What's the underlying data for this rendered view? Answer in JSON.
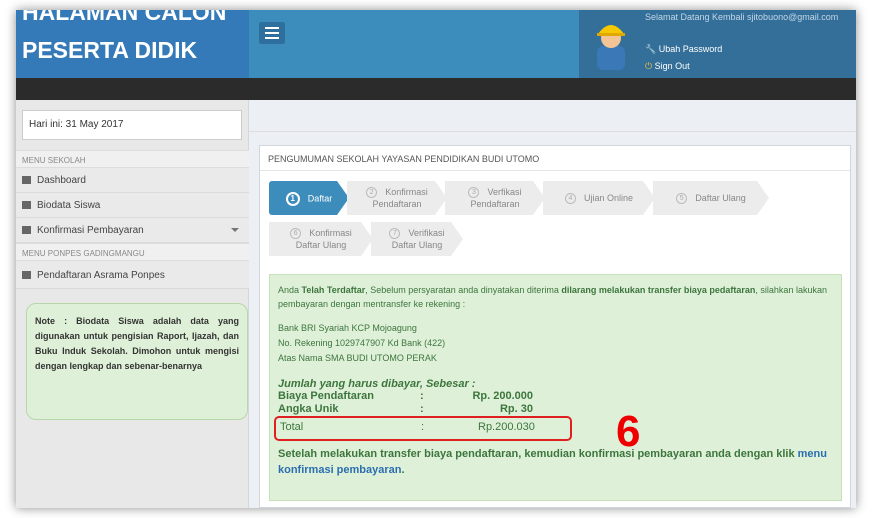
{
  "header": {
    "logo_line1": "HALAMAN CALON",
    "logo_line2": "PESERTA DIDIK",
    "greeting": "Selamat Datang Kembali sjitobuono@gmail.com",
    "change_password": "Ubah Password",
    "sign_out": "Sign Out"
  },
  "sidebar": {
    "date": "Hari ini: 31 May 2017",
    "section1": "MENU SEKOLAH",
    "items": [
      {
        "label": "Dashboard"
      },
      {
        "label": "Biodata Siswa"
      },
      {
        "label": "Konfirmasi Pembayaran"
      }
    ],
    "section2": "MENU PONPES GADINGMANGU",
    "ponpes_item": "Pendaftaran Asrama Ponpes",
    "note": "Note : Biodata Siswa adalah data yang digunakan untuk pengisian Raport, Ijazah, dan Buku Induk Sekolah. Dimohon untuk mengisi dengan lengkap dan sebenar-benarnya"
  },
  "main": {
    "box_title": "PENGUMUMAN SEKOLAH YAYASAN PENDIDIKAN BUDI UTOMO",
    "steps": [
      {
        "num": "1",
        "line1": "Daftar",
        "line2": ""
      },
      {
        "num": "2",
        "line1": "Konfirmasi",
        "line2": "Pendaftaran"
      },
      {
        "num": "3",
        "line1": "Verfikasi",
        "line2": "Pendaftaran"
      },
      {
        "num": "4",
        "line1": "Ujian Online",
        "line2": ""
      },
      {
        "num": "5",
        "line1": "Daftar Ulang",
        "line2": ""
      },
      {
        "num": "6",
        "line1": "Konfirmasi",
        "line2": "Daftar Ulang"
      },
      {
        "num": "7",
        "line1": "Verifikasi",
        "line2": "Daftar Ulang"
      }
    ],
    "info": {
      "t1": "Anda ",
      "t2": "Telah Terdaftar",
      "t3": ", Sebelum persyaratan anda dinyatakan diterima ",
      "t4": "dilarang melakukan transfer biaya pedaftaran",
      "t5": ", silahkan lakukan pembayaran dengan mentransfer ke rekening :",
      "bank_lines": [
        "Bank BRI Syariah KCP Mojoagung",
        "No. Rekening 1029747907 Kd Bank (422)",
        "Atas Nama SMA BUDI UTOMO PERAK"
      ],
      "heading": "Jumlah yang harus dibayar, Sebesar :",
      "rows": [
        {
          "label": "Biaya Pendaftaran",
          "colon": ":",
          "value": "Rp. 200.000"
        },
        {
          "label": "Angka Unik",
          "colon": ":",
          "value": "Rp. 30"
        }
      ],
      "total_label": "Total",
      "total_colon": ":",
      "total_value": "Rp.200.030",
      "footnote_a": "Setelah melakukan transfer biaya pendaftaran, kemudian konfirmasi pembayaran anda dengan klik ",
      "footnote_link": "menu konfirmasi pembayaran",
      "footnote_b": "."
    },
    "annotation": "6"
  },
  "colors": {
    "header_blue": "#3c8dbc",
    "logo_blue": "#357ab8",
    "success_bg": "#dff0d8",
    "success_text": "#3c763d",
    "highlight_red": "#e02020"
  }
}
